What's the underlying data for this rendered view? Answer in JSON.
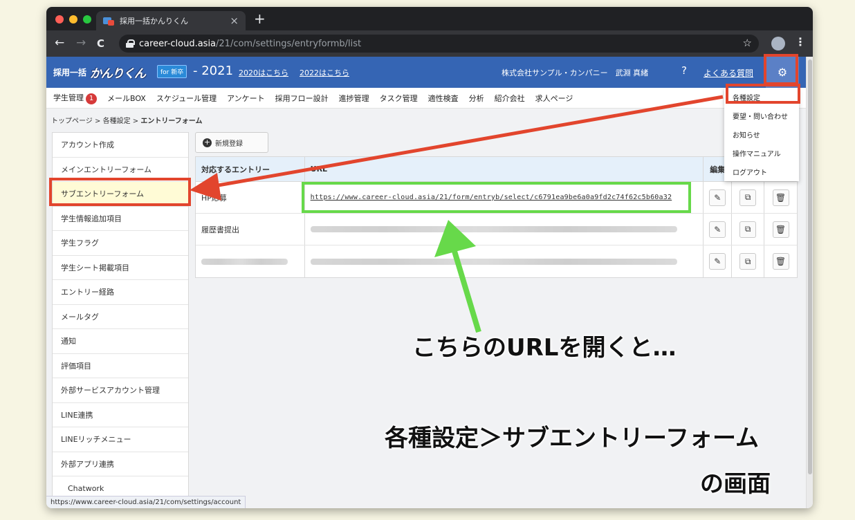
{
  "browser": {
    "tab_title": "採用一括かんりくん",
    "close_tab": "×",
    "new_tab": "+",
    "back": "←",
    "forward": "→",
    "reload": "C",
    "url_host": "career-cloud.asia",
    "url_path": "/21/com/settings/entryformb/list",
    "bookmark_star": "☆",
    "menu": "⋮",
    "status_url": "https://www.career-cloud.asia/21/com/settings/account"
  },
  "header": {
    "brand_prefix": "採用一括",
    "brand_name": "かんりくん",
    "brand_badge": "for 新卒",
    "year": "- 2021",
    "link_2020": "2020はこちら",
    "link_2022": "2022はこちら",
    "company": "株式会社サンプル・カンパニー　武淵 真緒",
    "faq_icon": "?",
    "faq": "よくある質問",
    "gear": "⚙"
  },
  "menu": {
    "items": [
      "学生管理",
      "メールBOX",
      "スケジュール管理",
      "アンケート",
      "採用フロー設計",
      "進捗管理",
      "タスク管理",
      "適性検査",
      "分析",
      "紹介会社",
      "求人ページ"
    ],
    "badge_count": "1"
  },
  "breadcrumb": {
    "home": "トップページ",
    "sep": ">",
    "settings": "各種設定",
    "current": "エントリーフォーム"
  },
  "sidebar": {
    "items": [
      "アカウント作成",
      "メインエントリーフォーム",
      "サブエントリーフォーム",
      "学生情報追加項目",
      "学生フラグ",
      "学生シート掲載項目",
      "エントリー経路",
      "メールタグ",
      "通知",
      "評価項目",
      "外部サービスアカウント管理",
      "LINE連携",
      "LINEリッチメニュー",
      "外部アプリ連携",
      "Chatwork"
    ]
  },
  "content": {
    "new_button": "新規登録",
    "new_button_icon": "+",
    "columns": {
      "entry": "対応するエントリー",
      "url": "URL",
      "edit": "編集"
    },
    "rows": [
      {
        "name": "HP応募",
        "url": "https://www.career-cloud.asia/21/form/entryb/select/c6791ea9be6a0a9fd2c74f62c5b60a32"
      },
      {
        "name": "履歴書提出",
        "url": ""
      },
      {
        "name": "",
        "url": ""
      }
    ],
    "icons": {
      "edit": "✎",
      "copy": "⧉",
      "delete": "🗑"
    }
  },
  "dropdown": {
    "items": [
      "各種設定",
      "要望・問い合わせ",
      "お知らせ",
      "操作マニュアル",
      "ログアウト"
    ]
  },
  "annotations": {
    "open_url": "こちらのURLを開くと…",
    "screen_line1": "各種設定＞サブエントリーフォーム",
    "screen_line2": "の画面"
  },
  "colors": {
    "header_blue": "#3565b4",
    "highlight_red": "#e2452d",
    "highlight_green": "#67d94a",
    "active_item": "#fffbd6"
  }
}
